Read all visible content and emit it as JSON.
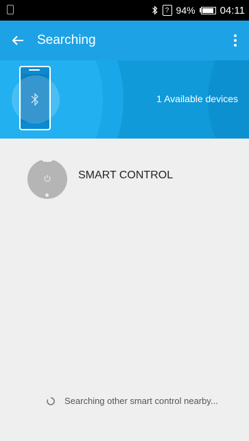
{
  "status_bar": {
    "battery_percent": "94%",
    "time": "04:11",
    "sim_glyph": "?",
    "icons": [
      "notification-icon",
      "bluetooth-icon",
      "sim-icon",
      "battery-icon"
    ]
  },
  "app_bar": {
    "title": "Searching",
    "back_icon": "back-arrow-icon",
    "menu_icon": "overflow-menu-icon"
  },
  "banner": {
    "available_text": "1 Available devices",
    "icons": [
      "phone-icon",
      "bluetooth-icon"
    ]
  },
  "devices": [
    {
      "name": "SMART CONTROL",
      "icon": "power-icon"
    }
  ],
  "footer": {
    "searching_text": "Searching other smart control nearby..."
  },
  "colors": {
    "app_bar": "#1ea2e6",
    "banner": "#109ad9",
    "background": "#efefef",
    "device_icon": "#b5b5b5"
  }
}
